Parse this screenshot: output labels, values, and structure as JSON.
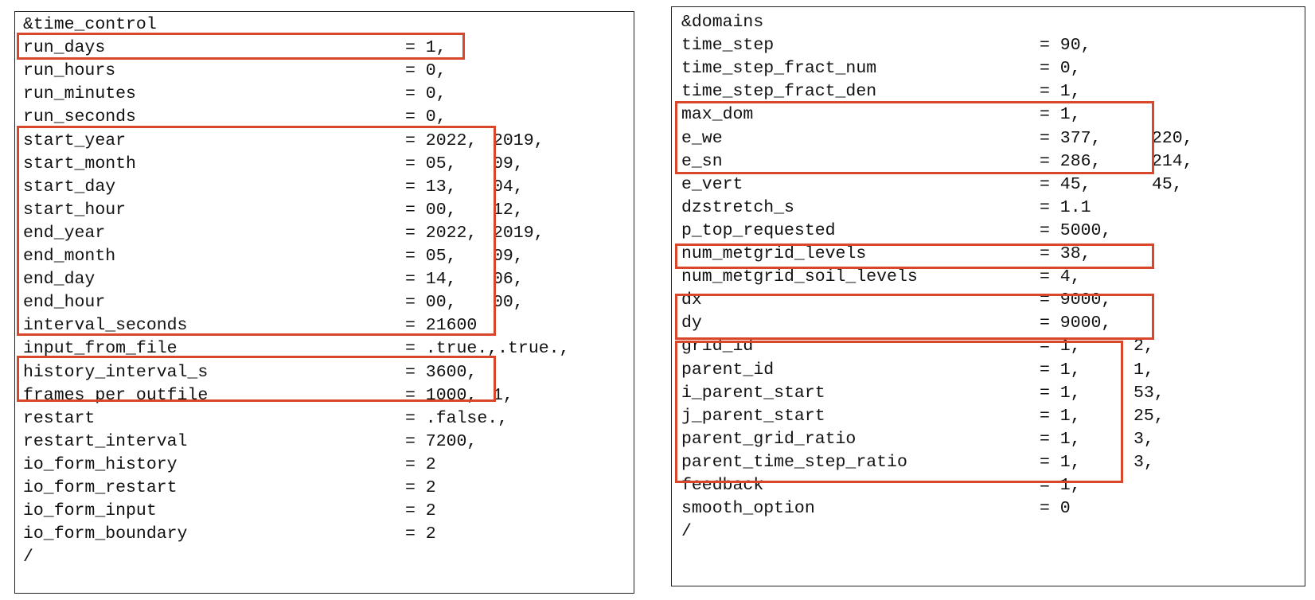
{
  "highlight_color": "#d9472b",
  "left_panel": {
    "header": "&time_control",
    "footer": "/",
    "rows": [
      {
        "name": "run_days",
        "eq": "= 1,",
        "extra": ""
      },
      {
        "name": "run_hours",
        "eq": "= 0,",
        "extra": ""
      },
      {
        "name": "run_minutes",
        "eq": "= 0,",
        "extra": ""
      },
      {
        "name": "run_seconds",
        "eq": "= 0,",
        "extra": ""
      },
      {
        "name": "start_year",
        "eq": "= 2022,",
        "extra": "2019,"
      },
      {
        "name": "start_month",
        "eq": "= 05,",
        "extra": "09,"
      },
      {
        "name": "start_day",
        "eq": "= 13,",
        "extra": "04,"
      },
      {
        "name": "start_hour",
        "eq": "= 00,",
        "extra": "12,"
      },
      {
        "name": "end_year",
        "eq": "= 2022,",
        "extra": "2019,"
      },
      {
        "name": "end_month",
        "eq": "= 05,",
        "extra": "09,"
      },
      {
        "name": "end_day",
        "eq": "= 14,",
        "extra": "06,"
      },
      {
        "name": "end_hour",
        "eq": "= 00,",
        "extra": "00,"
      },
      {
        "name": "interval_seconds",
        "eq": "= 21600",
        "extra": ""
      },
      {
        "name": "input_from_file",
        "eq": "= .true.,.true.,",
        "extra": ""
      },
      {
        "name": "history_interval_s",
        "eq": "= 3600,",
        "extra": ""
      },
      {
        "name": "frames_per_outfile",
        "eq": "= 1000,",
        "extra": "1,"
      },
      {
        "name": "restart",
        "eq": "= .false.,",
        "extra": ""
      },
      {
        "name": "restart_interval",
        "eq": "= 7200,",
        "extra": ""
      },
      {
        "name": "io_form_history",
        "eq": "= 2",
        "extra": ""
      },
      {
        "name": "io_form_restart",
        "eq": "= 2",
        "extra": ""
      },
      {
        "name": "io_form_input",
        "eq": "= 2",
        "extra": ""
      },
      {
        "name": "io_form_boundary",
        "eq": "= 2",
        "extra": ""
      }
    ]
  },
  "right_panel": {
    "header": "&domains",
    "footer": "/",
    "rows": [
      {
        "name": "time_step",
        "eq": "= 90,",
        "extra": ""
      },
      {
        "name": "time_step_fract_num",
        "eq": "= 0,",
        "extra": ""
      },
      {
        "name": "time_step_fract_den",
        "eq": "= 1,",
        "extra": ""
      },
      {
        "name": "max_dom",
        "eq": "= 1,",
        "extra": ""
      },
      {
        "name": "e_we",
        "eq": "= 377,",
        "extra": "220,"
      },
      {
        "name": "e_sn",
        "eq": "= 286,",
        "extra": "214,"
      },
      {
        "name": "e_vert",
        "eq": "= 45,",
        "extra": "45,"
      },
      {
        "name": "dzstretch_s",
        "eq": "= 1.1",
        "extra": ""
      },
      {
        "name": "p_top_requested",
        "eq": "= 5000,",
        "extra": ""
      },
      {
        "name": "num_metgrid_levels",
        "eq": "= 38,",
        "extra": ""
      },
      {
        "name": "num_metgrid_soil_levels",
        "eq": "= 4,",
        "extra": ""
      },
      {
        "name": "dx",
        "eq": "= 9000,",
        "extra": ""
      },
      {
        "name": "dy",
        "eq": "= 9000,",
        "extra": ""
      },
      {
        "name": "grid_id",
        "eq": "= 1,",
        "extra": "2,"
      },
      {
        "name": "parent_id",
        "eq": "= 1,",
        "extra": "1,"
      },
      {
        "name": "i_parent_start",
        "eq": "= 1,",
        "extra": "53,"
      },
      {
        "name": "j_parent_start",
        "eq": "= 1,",
        "extra": "25,"
      },
      {
        "name": "parent_grid_ratio",
        "eq": "= 1,",
        "extra": "3,"
      },
      {
        "name": "parent_time_step_ratio",
        "eq": "= 1,",
        "extra": "3,"
      },
      {
        "name": "feedback",
        "eq": "= 1,",
        "extra": ""
      },
      {
        "name": "smooth_option",
        "eq": "= 0",
        "extra": ""
      }
    ]
  }
}
